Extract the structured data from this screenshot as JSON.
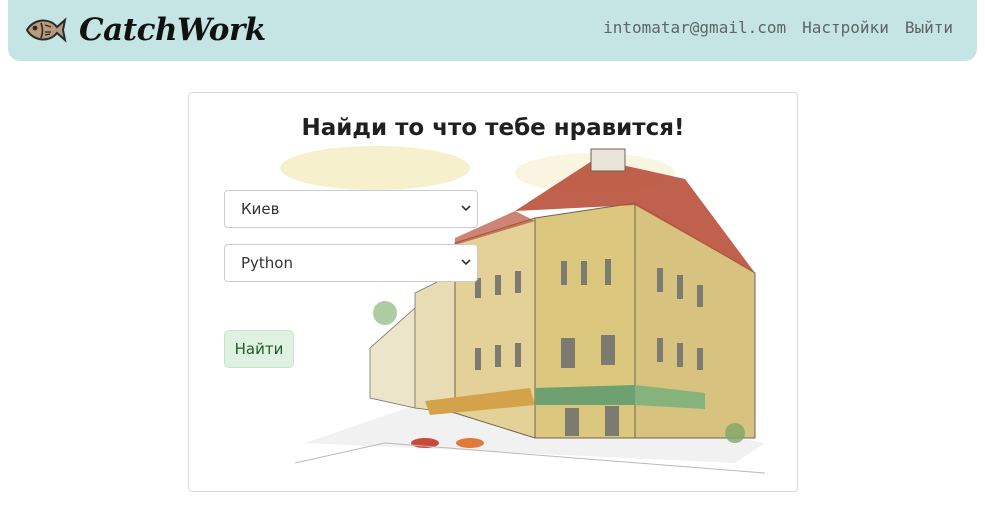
{
  "header": {
    "brand_name": "CatchWork",
    "brand_icon": "fish-icon",
    "email": "intomatar@gmail.com",
    "settings_label": "Настройки",
    "logout_label": "Выйти"
  },
  "search": {
    "title": "Найди то что тебе нравится!",
    "city_value": "Киев",
    "language_value": "Python",
    "submit_label": "Найти"
  },
  "colors": {
    "navbar_bg": "#c5e5e4",
    "button_bg": "#dff1e0",
    "button_text": "#1f5a28"
  }
}
